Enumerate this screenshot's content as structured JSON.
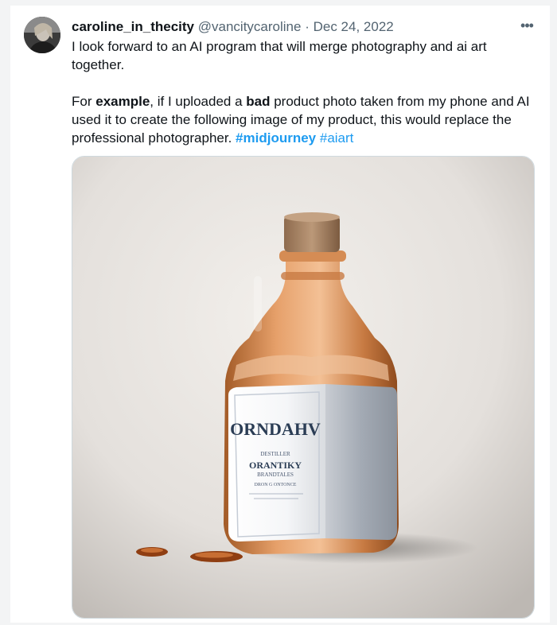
{
  "tweet": {
    "display_name": "caroline_in_thecity",
    "handle": "@vancitycaroline",
    "separator": "·",
    "date": "Dec 24, 2022",
    "more_label": "•••",
    "line1": "I look forward to an AI program that will merge photography and ai art together.",
    "p2_a": "For ",
    "p2_bold1": "example",
    "p2_b": ", if I uploaded a ",
    "p2_bold2": "bad",
    "p2_c": " product photo taken from my phone and AI used it to create the following image of my product, this would replace the professional photographer. ",
    "hashtag1": "#midjourney",
    "hashtag2": "#aiart"
  },
  "media": {
    "label_main": "ORNDAHV",
    "label_line1": "DESTILLER",
    "label_line2": "ORANTIKY",
    "label_line3": "BRANDTALES",
    "label_line4": "DRON G ONTONCE"
  },
  "colors": {
    "link": "#1d9bf0",
    "text": "#0f1419",
    "muted": "#536471",
    "amber": "#c8793e"
  }
}
